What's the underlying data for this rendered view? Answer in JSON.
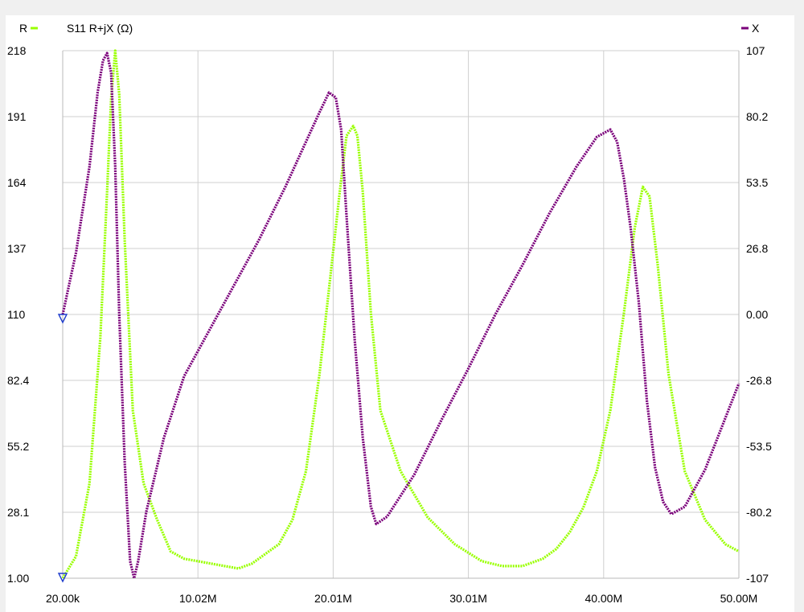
{
  "chart_data": {
    "type": "line",
    "title": "S11 R+jX (Ω)",
    "legend": {
      "left": {
        "label": "R",
        "color": "#99ff00"
      },
      "right": {
        "label": "X",
        "color": "#7a007a"
      }
    },
    "x_ticks": [
      "20.00k",
      "10.02M",
      "20.01M",
      "30.01M",
      "40.00M",
      "50.00M"
    ],
    "x_range": [
      0.02,
      50.0
    ],
    "x_unit": "MHz",
    "y_left": {
      "ticks": [
        "218",
        "191",
        "164",
        "137",
        "110",
        "82.4",
        "55.2",
        "28.1",
        "1.00"
      ],
      "range": [
        1.0,
        218.0
      ]
    },
    "y_right": {
      "ticks": [
        "107",
        "80.2",
        "53.5",
        "26.8",
        "0.00",
        "-26.8",
        "-53.5",
        "-80.2",
        "-107"
      ],
      "range": [
        -107.0,
        107.0
      ]
    },
    "grid": true,
    "series": [
      {
        "name": "R",
        "axis": "left",
        "color": "#99ff00",
        "x": [
          0.02,
          1.0,
          2.0,
          2.8,
          3.3,
          3.6,
          3.9,
          4.2,
          4.6,
          5.2,
          6.0,
          7.0,
          8.0,
          9.0,
          10.0,
          12.0,
          13.0,
          14.0,
          16.0,
          17.0,
          18.0,
          19.0,
          19.7,
          20.5,
          21.0,
          21.5,
          21.8,
          22.2,
          22.8,
          23.5,
          25.0,
          27.0,
          29.0,
          31.0,
          32.5,
          34.0,
          35.5,
          36.5,
          37.5,
          38.5,
          39.5,
          40.5,
          41.5,
          42.3,
          42.9,
          43.4,
          44.0,
          44.8,
          46.0,
          47.5,
          49.0,
          50.0
        ],
        "y": [
          1.0,
          10.0,
          40.0,
          100.0,
          160.0,
          198.0,
          218.0,
          200.0,
          140.0,
          70.0,
          40.0,
          25.0,
          12.0,
          9.0,
          8.0,
          6.0,
          5.0,
          7.0,
          15.0,
          25.0,
          45.0,
          85.0,
          120.0,
          160.0,
          183.0,
          187.0,
          183.0,
          160.0,
          110.0,
          70.0,
          45.0,
          26.0,
          15.0,
          8.0,
          6.0,
          6.0,
          9.0,
          13.0,
          20.0,
          30.0,
          45.0,
          70.0,
          110.0,
          145.0,
          162.0,
          158.0,
          130.0,
          85.0,
          45.0,
          25.0,
          15.0,
          12.0
        ]
      },
      {
        "name": "X",
        "axis": "right",
        "color": "#7a007a",
        "x": [
          0.02,
          1.0,
          2.0,
          2.6,
          3.0,
          3.3,
          3.6,
          3.9,
          4.2,
          4.6,
          5.0,
          5.3,
          5.6,
          6.2,
          7.5,
          9.0,
          10.5,
          12.5,
          14.5,
          16.5,
          18.0,
          19.0,
          19.7,
          20.2,
          20.6,
          21.0,
          21.6,
          22.2,
          22.8,
          23.2,
          24.0,
          26.0,
          28.0,
          30.0,
          32.0,
          34.0,
          36.0,
          38.0,
          39.5,
          40.5,
          41.0,
          41.5,
          42.0,
          42.6,
          43.2,
          43.8,
          44.4,
          45.0,
          46.0,
          47.5,
          49.0,
          50.0
        ],
        "y": [
          0.0,
          25.0,
          60.0,
          90.0,
          103.0,
          106.0,
          98.0,
          60.0,
          0.0,
          -60.0,
          -100.0,
          -107.0,
          -100.0,
          -80.0,
          -50.0,
          -25.0,
          -10.0,
          10.0,
          30.0,
          52.0,
          70.0,
          82.0,
          90.0,
          88.0,
          75.0,
          40.0,
          -10.0,
          -50.0,
          -78.0,
          -85.0,
          -82.0,
          -65.0,
          -43.0,
          -22.0,
          0.0,
          20.0,
          41.0,
          60.0,
          72.0,
          75.0,
          70.0,
          55.0,
          35.0,
          5.0,
          -35.0,
          -62.0,
          -76.0,
          -81.0,
          -78.0,
          -63.0,
          -42.0,
          -28.0
        ]
      }
    ]
  }
}
